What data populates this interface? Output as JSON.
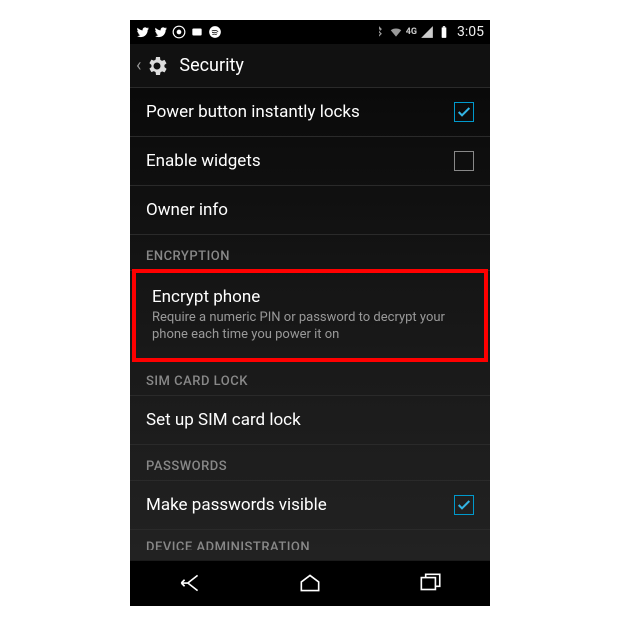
{
  "status": {
    "clock": "3:05",
    "network_label": "4G"
  },
  "header": {
    "title": "Security"
  },
  "items": {
    "power_lock": {
      "title": "Power button instantly locks",
      "checked": true
    },
    "enable_widgets": {
      "title": "Enable widgets",
      "checked": false
    },
    "owner_info": {
      "title": "Owner info"
    },
    "encrypt": {
      "title": "Encrypt phone",
      "subtitle": "Require a numeric PIN or password to decrypt your phone each time you power it on"
    },
    "sim_lock": {
      "title": "Set up SIM card lock"
    },
    "passwords_visible": {
      "title": "Make passwords visible",
      "checked": true
    }
  },
  "sections": {
    "encryption": "ENCRYPTION",
    "sim": "SIM CARD LOCK",
    "passwords": "PASSWORDS",
    "device_admin": "DEVICE ADMINISTRATION"
  }
}
